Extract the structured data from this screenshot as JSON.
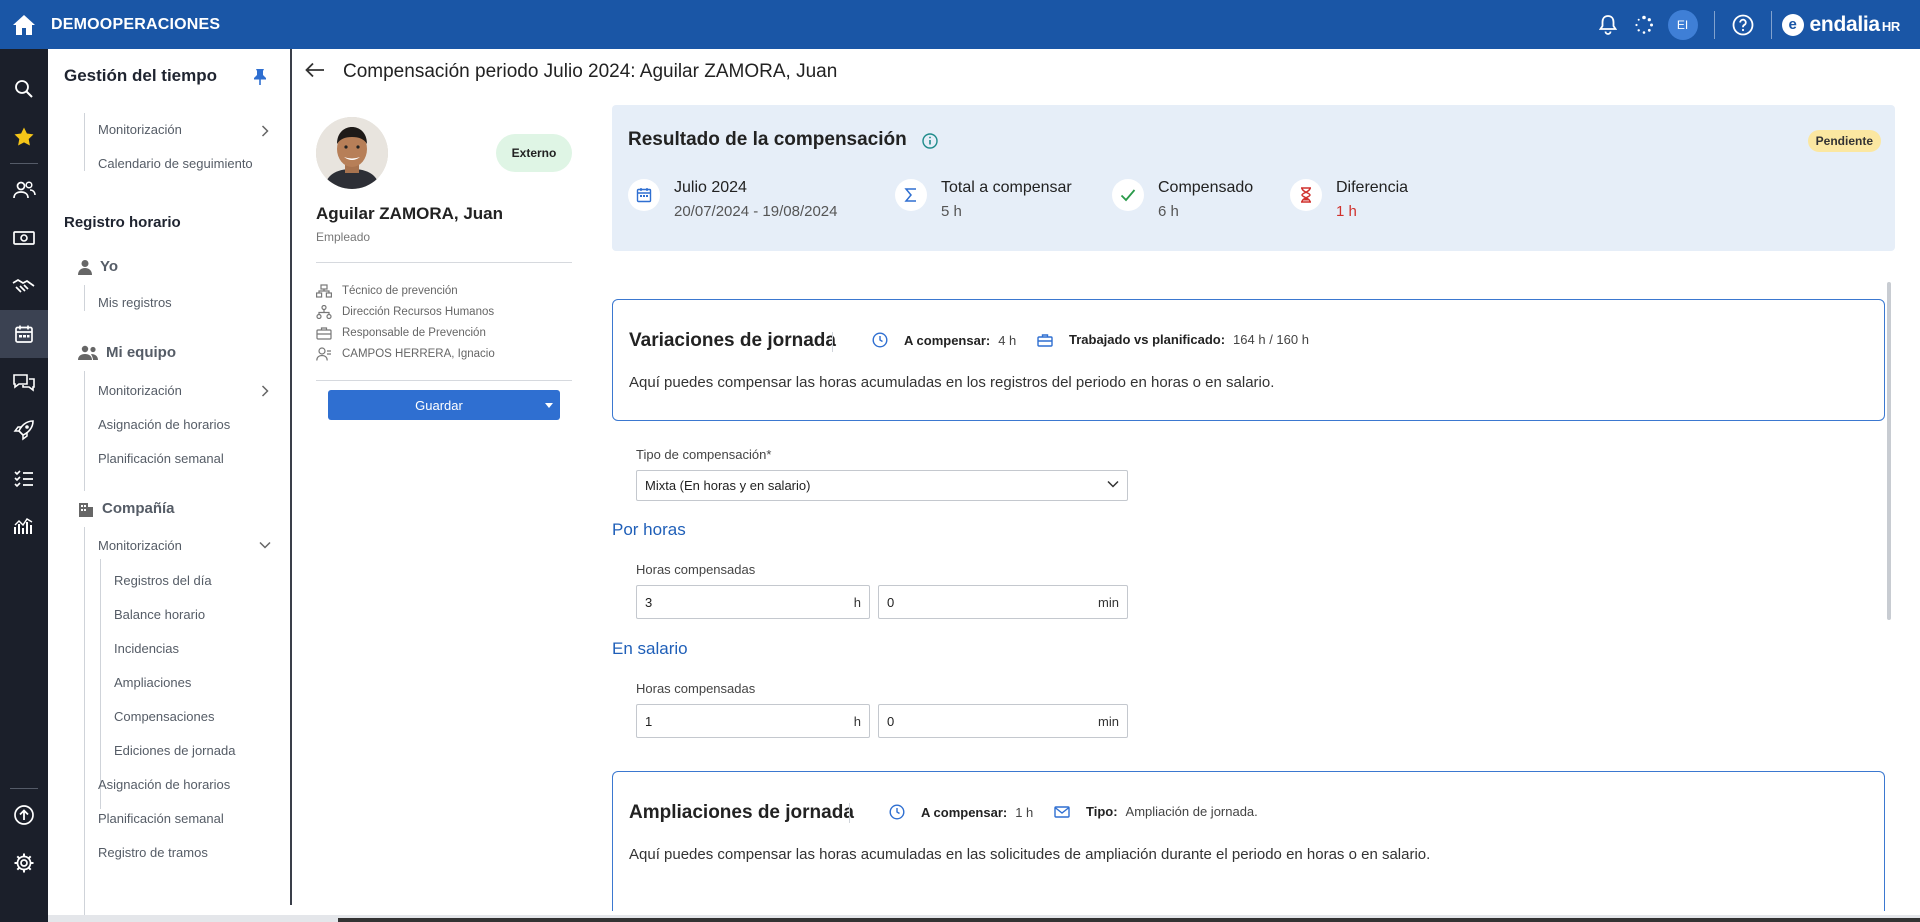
{
  "topbar": {
    "company": "DEMOOPERACIONES",
    "user_initials": "EI",
    "brand_name": "endalia",
    "brand_suffix": "HR",
    "brand_logo_letter": "e"
  },
  "rail": {
    "icons": [
      "search-icon",
      "star-icon",
      "people-icon",
      "money-icon",
      "handshake-icon",
      "calendar-icon",
      "chat-icon",
      "rocket-icon",
      "checklist-icon",
      "analytics-icon",
      "upload-icon",
      "settings-icon"
    ]
  },
  "sidebar": {
    "title": "Gestión del tiempo",
    "top_links": [
      "Monitorización",
      "Calendario de seguimiento"
    ],
    "section": "Registro horario",
    "yo": {
      "label": "Yo",
      "links": [
        "Mis registros"
      ]
    },
    "equipo": {
      "label": "Mi equipo",
      "links": [
        "Monitorización",
        "Asignación de horarios",
        "Planificación semanal"
      ]
    },
    "compania": {
      "label": "Compañía",
      "monitor": "Monitorización",
      "sub": [
        "Registros del día",
        "Balance horario",
        "Incidencias",
        "Ampliaciones",
        "Compensaciones",
        "Ediciones de jornada"
      ],
      "links": [
        "Asignación de horarios",
        "Planificación semanal",
        "Registro de tramos"
      ]
    }
  },
  "page": {
    "title": "Compensación periodo Julio 2024: Aguilar ZAMORA, Juan"
  },
  "employee": {
    "badge": "Externo",
    "name": "Aguilar ZAMORA, Juan",
    "role": "Empleado",
    "details": [
      "Técnico de prevención",
      "Dirección Recursos Humanos",
      "Responsable de Prevención",
      "CAMPOS HERRERA, Ignacio"
    ],
    "save_label": "Guardar"
  },
  "result": {
    "title": "Resultado de la compensación",
    "status": "Pendiente",
    "period": {
      "label": "Julio 2024",
      "value": "20/07/2024 - 19/08/2024"
    },
    "total": {
      "label": "Total a compensar",
      "value": "5 h"
    },
    "compensado": {
      "label": "Compensado",
      "value": "6 h"
    },
    "diferencia": {
      "label": "Diferencia",
      "value": "1 h"
    },
    "colors": {
      "negative": "#d0312d",
      "panel": "#e6eef8",
      "status": "#fbe7a1"
    }
  },
  "variaciones": {
    "title": "Variaciones de jornada",
    "a_compensar_label": "A compensar:",
    "a_compensar_value": "4 h",
    "trabajado_label": "Trabajado vs planificado:",
    "trabajado_value": "164 h / 160 h",
    "description": "Aquí puedes compensar las horas acumuladas en los registros del periodo en horas o en salario.",
    "tipo_label": "Tipo de compensación*",
    "tipo_value": "Mixta (En horas y en salario)",
    "por_horas": {
      "title": "Por horas",
      "label": "Horas compensadas",
      "hours": "3",
      "hours_unit": "h",
      "mins": "0",
      "mins_unit": "min"
    },
    "en_salario": {
      "title": "En salario",
      "label": "Horas compensadas",
      "hours": "1",
      "hours_unit": "h",
      "mins": "0",
      "mins_unit": "min"
    }
  },
  "ampliaciones": {
    "title": "Ampliaciones de jornada",
    "a_compensar_label": "A compensar:",
    "a_compensar_value": "1 h",
    "tipo_label": "Tipo:",
    "tipo_value": "Ampliación de jornada.",
    "description": "Aquí puedes compensar las horas acumuladas en las solicitudes de ampliación durante el periodo en horas o en salario."
  }
}
